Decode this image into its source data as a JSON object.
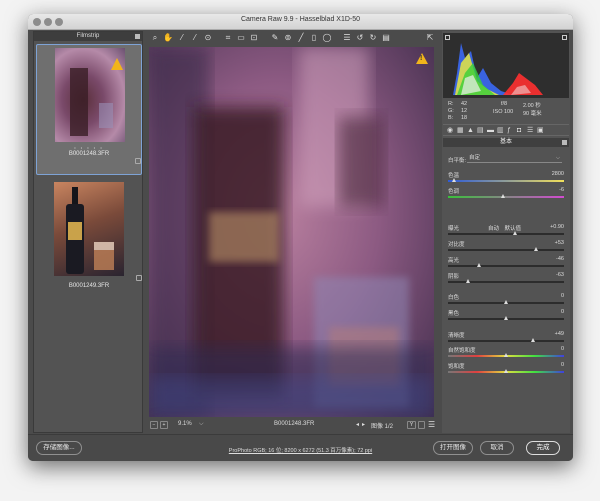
{
  "window": {
    "title": "Camera Raw 9.9 -  Hasselblad X1D-50"
  },
  "filmstrip": {
    "header": "Filmstrip",
    "items": [
      {
        "name": "B0001248.3FR",
        "stars": "• • • • •"
      },
      {
        "name": "B0001249.3FR",
        "stars": ""
      }
    ]
  },
  "toolbar": {
    "icons": [
      "zoom-icon",
      "hand-icon",
      "white-balance-icon",
      "color-sampler-icon",
      "target-adjust-icon",
      "crop-icon",
      "straighten-icon",
      "transform-icon",
      "spot-removal-icon",
      "red-eye-icon",
      "adjustment-brush-icon",
      "graduated-filter-icon",
      "radial-filter-icon",
      "preferences-icon",
      "rotate-ccw-icon",
      "rotate-cw-icon",
      "trash-icon"
    ],
    "fullscreen": "⇱"
  },
  "preview": {
    "warning": "!"
  },
  "bottombar": {
    "zoom": "9.1%",
    "filename": "B0001248.3FR",
    "nav": "图像 1/2",
    "y_label": "Y"
  },
  "histogram": {
    "colors": {
      "blue": "#3b6cff",
      "red": "#ff3030",
      "green": "#38d038",
      "yellow": "#e8e840",
      "white": "#f0f0f0"
    }
  },
  "meta": {
    "r_label": "R:",
    "r_val": "42",
    "g_label": "G:",
    "g_val": "12",
    "b_label": "B:",
    "b_val": "18",
    "aperture": "f/8",
    "shutter": "2.00 秒",
    "iso": "ISO 100",
    "focal": "90 毫米"
  },
  "panel": {
    "section_title": "基本",
    "wb_label": "白平衡:",
    "wb_value": "自定",
    "auto": "自动",
    "default": "默认值",
    "sliders": [
      {
        "label": "色温",
        "value": "2800",
        "pos": 0.06,
        "track": "temp"
      },
      {
        "label": "色调",
        "value": "-6",
        "pos": 0.48,
        "track": "tint"
      },
      {
        "label": "曝光",
        "value": "+0.90",
        "pos": 0.58,
        "track": "gray"
      },
      {
        "label": "对比度",
        "value": "+53",
        "pos": 0.76,
        "track": "gray"
      },
      {
        "label": "高光",
        "value": "-46",
        "pos": 0.27,
        "track": "gray"
      },
      {
        "label": "阴影",
        "value": "-63",
        "pos": 0.18,
        "track": "gray"
      },
      {
        "label": "白色",
        "value": "0",
        "pos": 0.5,
        "track": "gray"
      },
      {
        "label": "黑色",
        "value": "0",
        "pos": 0.5,
        "track": "gray"
      },
      {
        "label": "清晰度",
        "value": "+49",
        "pos": 0.74,
        "track": "gray"
      },
      {
        "label": "自然饱和度",
        "value": "0",
        "pos": 0.5,
        "track": "sat"
      },
      {
        "label": "饱和度",
        "value": "0",
        "pos": 0.5,
        "track": "sat"
      }
    ]
  },
  "footer": {
    "save": "存储图像...",
    "workflow": "ProPhoto RGB; 16 位; 8200 x 6272 (51.3 百万像素); 72 ppi",
    "open": "打开图像",
    "cancel": "取消",
    "done": "完成"
  }
}
